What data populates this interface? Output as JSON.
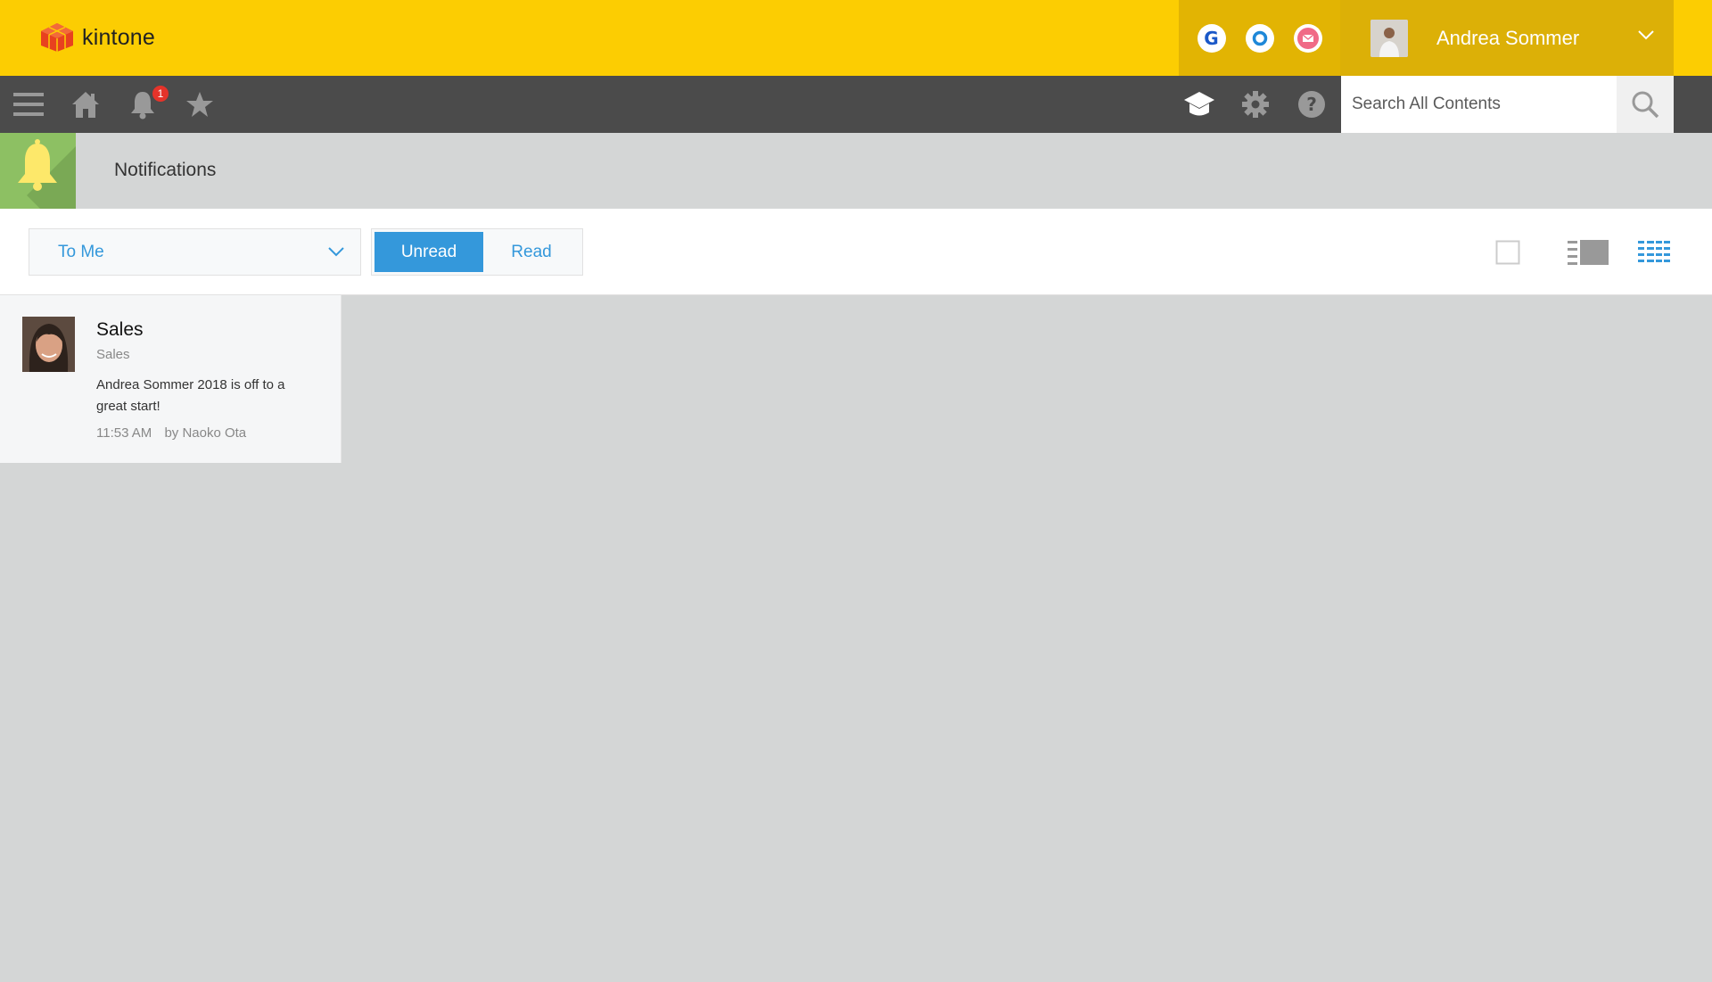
{
  "header": {
    "logo_text": "kintone",
    "user_name": "Andrea Sommer",
    "colors": {
      "header_bg": "#fccd02",
      "accent": "#3498db"
    }
  },
  "nav": {
    "notification_count": "1",
    "search_placeholder": "Search All Contents"
  },
  "page": {
    "title": "Notifications"
  },
  "filters": {
    "recipient_select": "To Me",
    "unread_label": "Unread",
    "read_label": "Read",
    "active_tab": "Unread"
  },
  "notifications": [
    {
      "title": "Sales",
      "app": "Sales",
      "message": "Andrea Sommer 2018 is off to a great start!",
      "time": "11:53 AM",
      "author": "by Naoko Ota"
    }
  ]
}
